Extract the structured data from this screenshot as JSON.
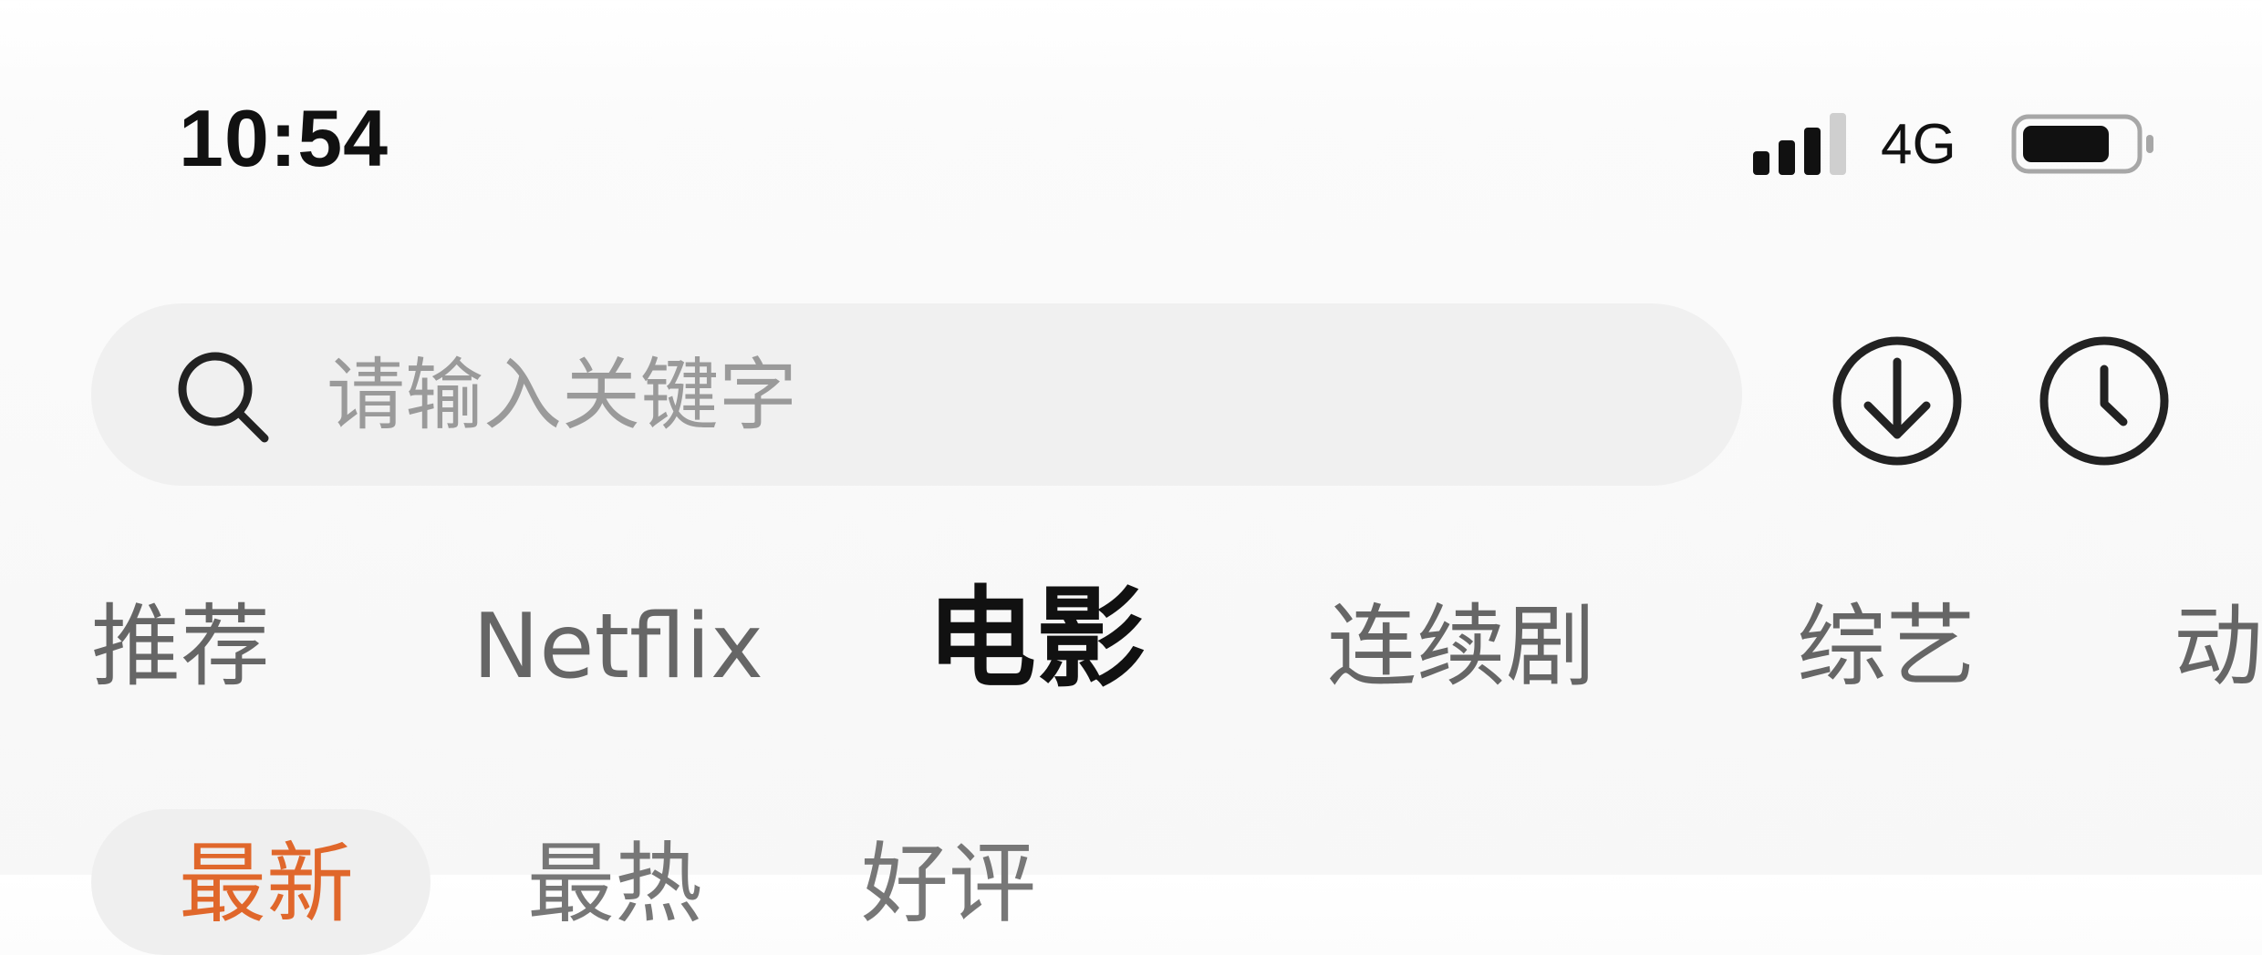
{
  "status_bar": {
    "time": "10:54",
    "network": "4G",
    "signal_bars_active": 3,
    "signal_bars_total": 4,
    "battery_level": 0.8
  },
  "search": {
    "placeholder": "请输入关键字",
    "download_icon": "download-icon",
    "history_icon": "history-icon"
  },
  "tabs": [
    {
      "label": "推荐"
    },
    {
      "label": "Netflix"
    },
    {
      "label": "电影",
      "active": true
    },
    {
      "label": "连续剧"
    },
    {
      "label": "综艺"
    },
    {
      "label": "动"
    }
  ],
  "sub_tabs": [
    {
      "label": "最新",
      "active": true
    },
    {
      "label": "最热"
    },
    {
      "label": "好评"
    }
  ],
  "colors": {
    "accent": "#e0672b",
    "tab_inactive": "#666666",
    "tab_active": "#111111",
    "placeholder": "#9a9a9a"
  }
}
